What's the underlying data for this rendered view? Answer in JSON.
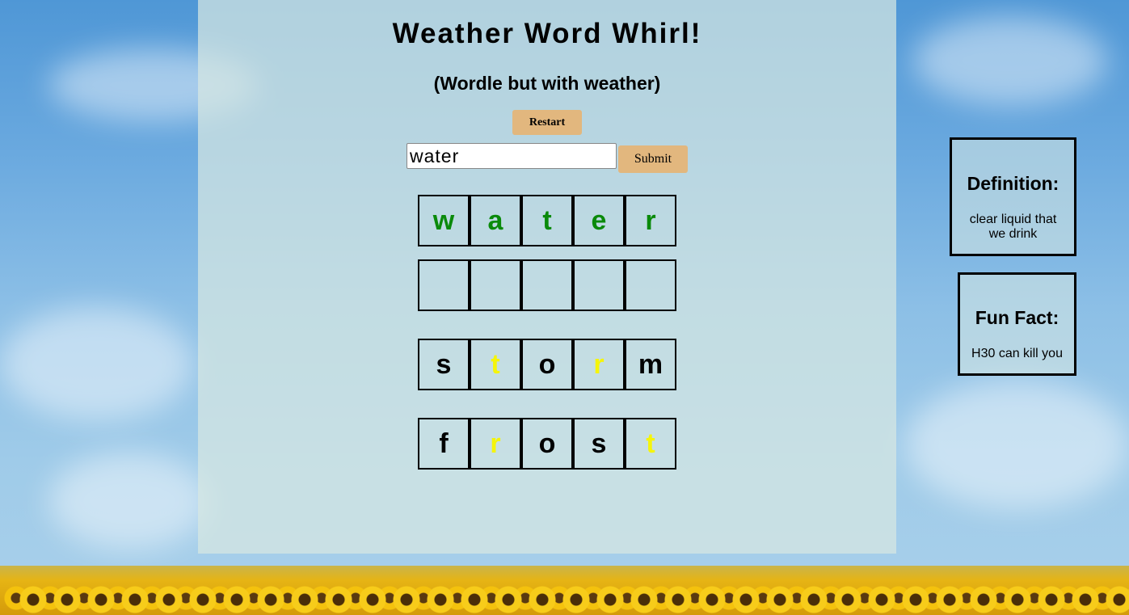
{
  "app": {
    "title": "Weather Word Whirl!",
    "subtitle": "(Wordle but with weather)"
  },
  "controls": {
    "restart_label": "Restart",
    "guess_value": "water",
    "submit_label": "Submit"
  },
  "board": {
    "rows": [
      {
        "letters": [
          "w",
          "a",
          "t",
          "e",
          "r"
        ],
        "states": [
          "green",
          "green",
          "green",
          "green",
          "green"
        ]
      },
      {
        "letters": [
          "",
          "",
          "",
          "",
          ""
        ],
        "states": [
          "empty",
          "empty",
          "empty",
          "empty",
          "empty"
        ]
      },
      {
        "letters": [
          "s",
          "t",
          "o",
          "r",
          "m"
        ],
        "states": [
          "black",
          "yellow",
          "black",
          "yellow",
          "black"
        ]
      },
      {
        "letters": [
          "f",
          "r",
          "o",
          "s",
          "t"
        ],
        "states": [
          "black",
          "yellow",
          "black",
          "black",
          "yellow"
        ]
      }
    ]
  },
  "colors": {
    "green": "#0a8a0a",
    "yellow": "#f5f50a",
    "button": "#e2b77e"
  },
  "definition": {
    "heading": "Definition:",
    "text": "clear liquid that we drink"
  },
  "fun_fact": {
    "heading": "Fun Fact:",
    "text": "H30 can kill you"
  }
}
